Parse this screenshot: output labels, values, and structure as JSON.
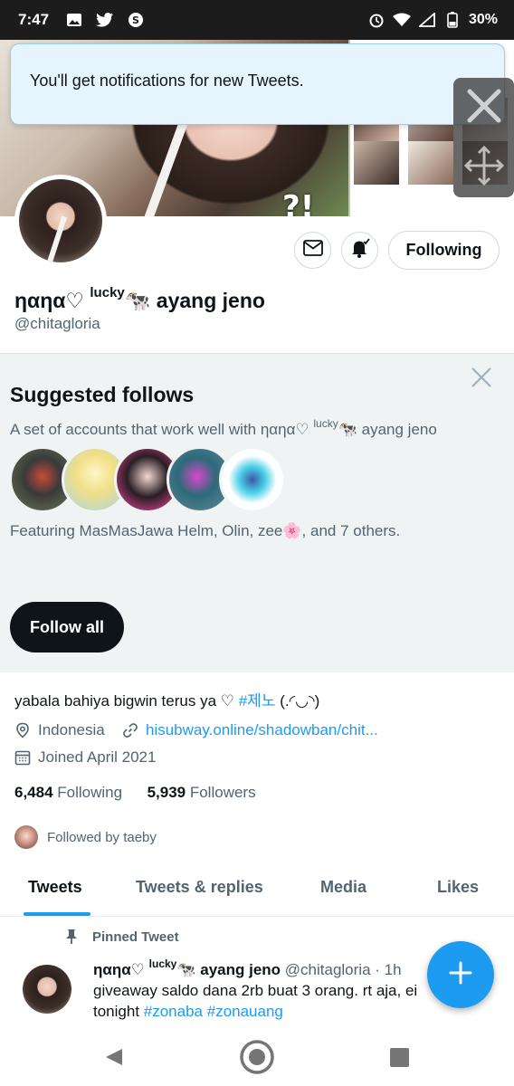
{
  "status_bar": {
    "time": "7:47",
    "battery": "30%",
    "left_icons": [
      "gallery-icon",
      "twitter-icon",
      "skype-icon"
    ],
    "right_icons": [
      "alarm-icon",
      "wifi-icon",
      "signal-icon",
      "battery-icon"
    ]
  },
  "toast": {
    "message": "You'll get notifications for new Tweets."
  },
  "banner": {
    "overlay_text": "?!"
  },
  "profile": {
    "display_name_pre": "ηαηα♡",
    "display_name_sup": "lucky",
    "display_name_emoji": "🐄",
    "display_name_post": "ayang jeno",
    "handle": "@chitagloria",
    "following_button": "Following"
  },
  "suggested": {
    "title": "Suggested follows",
    "subtitle_pre": "A set of accounts that work well with ηαηα♡",
    "subtitle_sup": "lucky",
    "subtitle_post": "🐄 ayang jeno",
    "featuring": "Featuring MasMasJawa Helm, Olin, zee🌸, and 7 others.",
    "follow_all": "Follow all"
  },
  "bio": {
    "text": "yabala bahiya bigwin terus ya ♡ ",
    "hashtag": "#제노",
    "suffix": " (.◜◡◝)",
    "location": "Indonesia",
    "link": "hisubway.online/shadowban/chit...",
    "joined": "Joined April 2021",
    "following_count": "6,484",
    "following_label": "Following",
    "followers_count": "5,939",
    "followers_label": "Followers",
    "followed_by": "Followed by taeby"
  },
  "tabs": [
    {
      "label": "Tweets"
    },
    {
      "label": "Tweets & replies"
    },
    {
      "label": "Media"
    },
    {
      "label": "Likes"
    }
  ],
  "tweet": {
    "pinned_label": "Pinned Tweet",
    "name_pre": "ηαηα♡",
    "name_sup": "lucky",
    "name_post": "🐄 ayang jeno",
    "handle_time": "@chitagloria · 1h",
    "body_line1": "giveaway saldo dana 2rb buat 3 orang. rt aja, ei",
    "body_line2_pre": "tonight ",
    "tag1": "#zonaba",
    "tag2": "#zonauang"
  },
  "colors": {
    "accent": "#1d9bf0",
    "toast_bg": "#e6f5fd",
    "panel_bg": "#f0f3f4",
    "text_secondary": "#536471"
  }
}
